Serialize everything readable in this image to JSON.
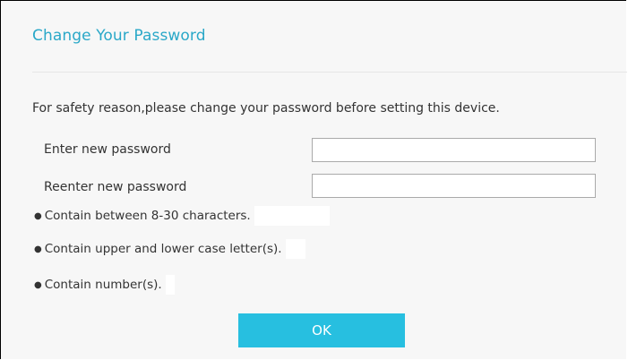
{
  "dialog": {
    "title": "Change Your Password",
    "safety_message": "For safety reason,please change your password before setting this device.",
    "fields": {
      "new_password_label": "Enter new password",
      "new_password_value": "",
      "reenter_password_label": "Reenter new password",
      "reenter_password_value": ""
    },
    "rules": [
      "Contain between 8-30 characters.",
      "Contain upper and lower case letter(s).",
      "Contain number(s)."
    ],
    "ok_label": "OK"
  },
  "colors": {
    "title": "#2aa8c8",
    "button": "#27bfe0",
    "background": "#f7f7f7"
  }
}
